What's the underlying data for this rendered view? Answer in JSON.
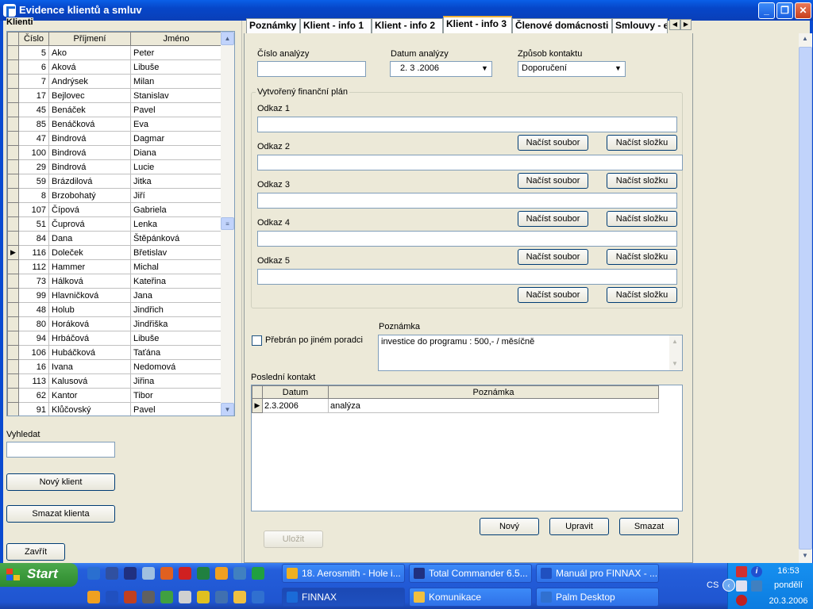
{
  "window": {
    "title": "Evidence klientů a smluv",
    "controls": {
      "minimize": "_",
      "maximize": "❐",
      "close": "✕"
    }
  },
  "left": {
    "group_label": "Klienti",
    "columns": {
      "num": "Číslo",
      "surname": "Příjmení",
      "name": "Jméno"
    },
    "rows": [
      {
        "num": "5",
        "surname": "Ako",
        "name": "Peter"
      },
      {
        "num": "6",
        "surname": "Aková",
        "name": "Libuše"
      },
      {
        "num": "7",
        "surname": "Andrýsek",
        "name": "Milan"
      },
      {
        "num": "17",
        "surname": "Bejlovec",
        "name": "Stanislav"
      },
      {
        "num": "45",
        "surname": "Benáček",
        "name": "Pavel"
      },
      {
        "num": "85",
        "surname": "Benáčková",
        "name": "Eva"
      },
      {
        "num": "47",
        "surname": "Bindrová",
        "name": "Dagmar"
      },
      {
        "num": "100",
        "surname": "Bindrová",
        "name": "Diana"
      },
      {
        "num": "29",
        "surname": "Bindrová",
        "name": "Lucie"
      },
      {
        "num": "59",
        "surname": "Brázdilová",
        "name": "Jitka"
      },
      {
        "num": "8",
        "surname": "Brzobohatý",
        "name": "Jiří"
      },
      {
        "num": "107",
        "surname": "Čípová",
        "name": "Gabriela"
      },
      {
        "num": "51",
        "surname": "Čuprová",
        "name": "Lenka"
      },
      {
        "num": "84",
        "surname": "Dana",
        "name": "Štěpánková"
      },
      {
        "num": "116",
        "surname": "Doleček",
        "name": "Břetislav",
        "current": true
      },
      {
        "num": "112",
        "surname": "Hammer",
        "name": "Michal"
      },
      {
        "num": "73",
        "surname": "Hálková",
        "name": "Kateřina"
      },
      {
        "num": "99",
        "surname": "Hlavničková",
        "name": "Jana"
      },
      {
        "num": "48",
        "surname": "Holub",
        "name": "Jindřich"
      },
      {
        "num": "80",
        "surname": "Horáková",
        "name": "Jindřiška"
      },
      {
        "num": "94",
        "surname": "Hrbáčová",
        "name": "Libuše"
      },
      {
        "num": "106",
        "surname": "Hubáčková",
        "name": "Taťána"
      },
      {
        "num": "16",
        "surname": "Ivana",
        "name": "Nedomová"
      },
      {
        "num": "113",
        "surname": "Kalusová",
        "name": "Jiřina"
      },
      {
        "num": "62",
        "surname": "Kantor",
        "name": "Tibor"
      },
      {
        "num": "91",
        "surname": "Klůčovský",
        "name": "Pavel"
      }
    ],
    "search_label": "Vyhledat",
    "search_value": "",
    "new_client": "Nový klient",
    "delete_client": "Smazat klienta",
    "close": "Zavřít"
  },
  "tabs": [
    {
      "label": "Poznámky"
    },
    {
      "label": "Klient - info 1"
    },
    {
      "label": "Klient - info 2"
    },
    {
      "label": "Klient - info 3",
      "active": true
    },
    {
      "label": "Členové domácnosti"
    },
    {
      "label": "Smlouvy - e"
    }
  ],
  "form": {
    "analysis_number_label": "Číslo analýzy",
    "analysis_number_value": "",
    "analysis_date_label": "Datum analýzy",
    "analysis_date_value": "2. 3 .2006",
    "contact_method_label": "Způsob kontaktu",
    "contact_method_value": "Doporučení",
    "plan_group_label": "Vytvořený finanční plán",
    "links": [
      {
        "label": "Odkaz 1",
        "value": ""
      },
      {
        "label": "Odkaz 2",
        "value": ""
      },
      {
        "label": "Odkaz 3",
        "value": ""
      },
      {
        "label": "Odkaz 4",
        "value": ""
      },
      {
        "label": "Odkaz 5",
        "value": ""
      }
    ],
    "load_file": "Načíst soubor",
    "load_folder": "Načíst složku",
    "taken_over_label": "Přebrán po jiném poradci",
    "note_label": "Poznámka",
    "note_value": "investice do programu : 500,- / měsíčně",
    "last_contact_label": "Poslední kontakt",
    "contact_columns": {
      "date": "Datum",
      "note": "Poznámka"
    },
    "contact_rows": [
      {
        "date": "2.3.2006",
        "note": "analýza"
      }
    ],
    "btn_new": "Nový",
    "btn_edit": "Upravit",
    "btn_delete": "Smazat",
    "btn_save": "Uložit"
  },
  "taskbar": {
    "start": "Start",
    "tasks_row1": [
      {
        "label": "18. Aerosmith - Hole i...",
        "color": "#f0b020"
      },
      {
        "label": "Total Commander 6.5...",
        "color": "#203080"
      },
      {
        "label": "Manuál pro FINNAX - ...",
        "color": "#2050c0"
      }
    ],
    "tasks_row2": [
      {
        "label": "FINNAX",
        "color": "#1a6bd8",
        "active": true
      },
      {
        "label": "Komunikace",
        "color": "#f0c040"
      },
      {
        "label": "Palm Desktop",
        "color": "#3070d0"
      }
    ],
    "lang": "CS",
    "clock": "16:53",
    "day": "pondělí",
    "date": "20.3.2006"
  }
}
